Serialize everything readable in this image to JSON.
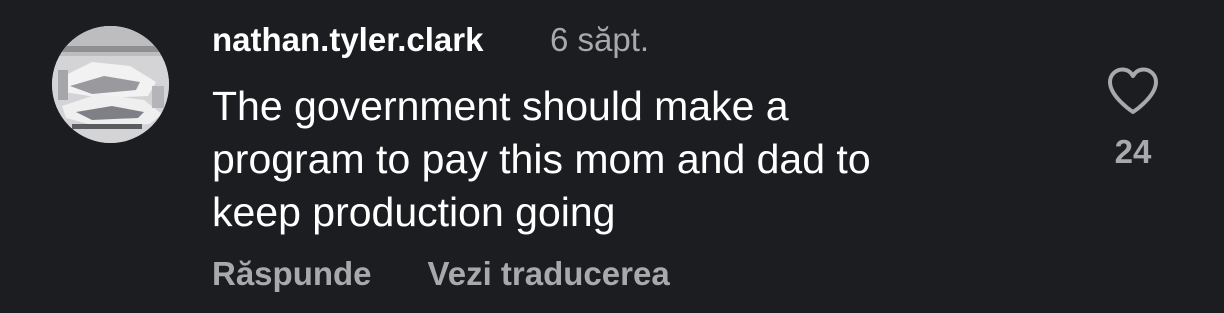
{
  "comment": {
    "username": "nathan.tyler.clark",
    "timestamp": "6 săpt.",
    "text_lines": [
      "The government should make a",
      "program to pay this mom and dad to",
      "keep production going"
    ],
    "reply_label": "Răspunde",
    "translate_label": "Vezi traducerea",
    "like_count": "24",
    "like_icon": "heart-outline-icon"
  },
  "colors": {
    "background": "#1b1d20",
    "primary_text": "#ffffff",
    "secondary_text": "#a8a9ad"
  }
}
